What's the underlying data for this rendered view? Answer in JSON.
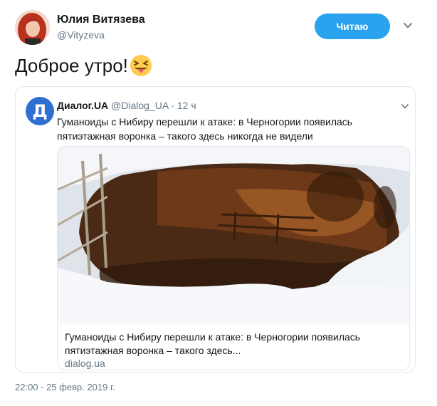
{
  "author": {
    "name": "Юлия Витязева",
    "handle": "@Vityzeva"
  },
  "follow_button": {
    "label": "Читаю"
  },
  "tweet": {
    "text": "Доброе утро!",
    "emoji": "squinting-tongue-emoji"
  },
  "quoted": {
    "avatar_letter": "Д",
    "name": "Диалог.UA",
    "handle": "@Dialog_UA",
    "separator": "·",
    "time": "12 ч",
    "text": "Гуманоиды с Нибиру перешли к атаке: в Черногории появилась пятиэтажная воронка – такого здесь никогда не видели",
    "card": {
      "title": "Гуманоиды с Нибиру перешли к атаке: в Черногории появилась пятиэтажная воронка – такого здесь...",
      "domain": "dialog.ua"
    }
  },
  "timestamp": "22:00 - 25 февр. 2019 г.",
  "colors": {
    "accent": "#2aa3ef",
    "quoted_avatar": "#2f6fd0",
    "secondary_text": "#657786"
  },
  "icons": {
    "menu": "chevron-down-icon"
  }
}
